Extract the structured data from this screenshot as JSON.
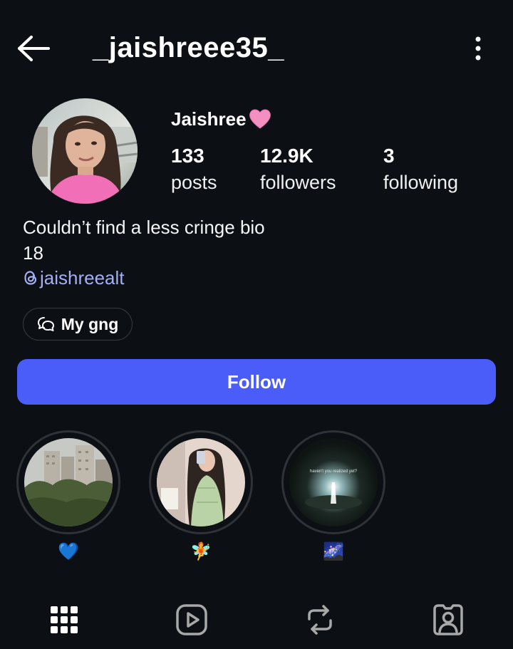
{
  "header": {
    "username": "_jaishreee35_",
    "back_icon": "arrow-left-icon",
    "more_icon": "vertical-dots-icon"
  },
  "profile": {
    "display_name": "Jaishree",
    "name_emoji": "pink-heart",
    "stats": [
      {
        "value": "133",
        "label": "posts"
      },
      {
        "value": "12.9K",
        "label": "followers"
      },
      {
        "value": "3",
        "label": "following"
      }
    ],
    "bio_lines": [
      "Couldn’t find a less cringe bio",
      "18"
    ],
    "threads_handle": "jaishreealt",
    "chat_chip_label": "My gng",
    "follow_label": "Follow"
  },
  "highlights": [
    {
      "label": "💙"
    },
    {
      "label": "🧚"
    },
    {
      "label": "🌌",
      "image_text": "haven't you realized yet?"
    }
  ],
  "tabs": [
    "grid-icon",
    "reels-icon",
    "reposts-icon",
    "tagged-icon"
  ],
  "colors": {
    "background": "#0c1014",
    "follow_button": "#4a5df9",
    "link": "#a3aef6",
    "ring": "#2f3338"
  }
}
